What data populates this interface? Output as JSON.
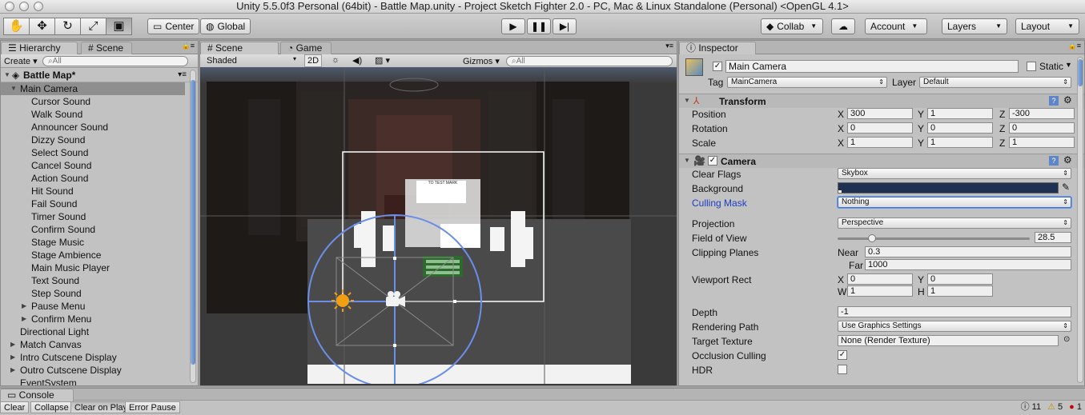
{
  "window": {
    "title": "Unity 5.5.0f3 Personal (64bit) - Battle Map.unity - Project Sketch Fighter 2.0 - PC, Mac & Linux Standalone (Personal) <OpenGL 4.1>"
  },
  "toolbar": {
    "tools": [
      "hand-icon",
      "move-icon",
      "rotate-icon",
      "scale-icon",
      "rect-icon"
    ],
    "pivot": "Center",
    "space": "Global",
    "collab": "Collab",
    "account": "Account",
    "layers": "Layers",
    "layout": "Layout"
  },
  "hierarchy": {
    "tab": "Hierarchy",
    "tab2": "Scene",
    "create": "Create",
    "search_placeholder": "All",
    "scene_name": "Battle Map*",
    "items": [
      {
        "label": "Main Camera",
        "indent": 1,
        "selected": true,
        "arrow": "open"
      },
      {
        "label": "Cursor Sound",
        "indent": 2
      },
      {
        "label": "Walk Sound",
        "indent": 2
      },
      {
        "label": "Announcer Sound",
        "indent": 2
      },
      {
        "label": "Dizzy Sound",
        "indent": 2
      },
      {
        "label": "Select Sound",
        "indent": 2
      },
      {
        "label": "Cancel Sound",
        "indent": 2
      },
      {
        "label": "Action Sound",
        "indent": 2
      },
      {
        "label": "Hit Sound",
        "indent": 2
      },
      {
        "label": "Fail Sound",
        "indent": 2
      },
      {
        "label": "Timer Sound",
        "indent": 2
      },
      {
        "label": "Confirm Sound",
        "indent": 2
      },
      {
        "label": "Stage Music",
        "indent": 2
      },
      {
        "label": "Stage Ambience",
        "indent": 2
      },
      {
        "label": "Main Music Player",
        "indent": 2
      },
      {
        "label": "Text Sound",
        "indent": 2
      },
      {
        "label": "Step Sound",
        "indent": 2
      },
      {
        "label": "Pause Menu",
        "indent": 2,
        "arrow": "closed"
      },
      {
        "label": "Confirm Menu",
        "indent": 2,
        "arrow": "closed"
      },
      {
        "label": "Directional Light",
        "indent": 1
      },
      {
        "label": "Match Canvas",
        "indent": 1,
        "arrow": "closed"
      },
      {
        "label": "Intro Cutscene Display",
        "indent": 1,
        "arrow": "closed"
      },
      {
        "label": "Outro Cutscene Display",
        "indent": 1,
        "arrow": "closed"
      },
      {
        "label": "EventSystem",
        "indent": 1
      }
    ]
  },
  "scene": {
    "tab": "Scene",
    "tab2": "Game",
    "shading": "Shaded",
    "mode2d": "2D",
    "gizmos": "Gizmos",
    "search_placeholder": "All",
    "ui_panel_title": "TO TEST MARK"
  },
  "inspector": {
    "tab": "Inspector",
    "object_name": "Main Camera",
    "static_label": "Static",
    "tag_label": "Tag",
    "tag": "MainCamera",
    "layer_label": "Layer",
    "layer": "Default",
    "transform": {
      "title": "Transform",
      "position_label": "Position",
      "position": {
        "x": "300",
        "y": "1",
        "z": "-300"
      },
      "rotation_label": "Rotation",
      "rotation": {
        "x": "0",
        "y": "0",
        "z": "0"
      },
      "scale_label": "Scale",
      "scale": {
        "x": "1",
        "y": "1",
        "z": "1"
      }
    },
    "camera": {
      "title": "Camera",
      "clear_flags_label": "Clear Flags",
      "clear_flags": "Skybox",
      "background_label": "Background",
      "background_color": "#1f3152",
      "culling_mask_label": "Culling Mask",
      "culling_mask": "Nothing",
      "projection_label": "Projection",
      "projection": "Perspective",
      "fov_label": "Field of View",
      "fov": "28.5",
      "fov_fraction": 0.16,
      "clipping_label": "Clipping Planes",
      "near_label": "Near",
      "near": "0.3",
      "far_label": "Far",
      "far": "1000",
      "viewport_label": "Viewport Rect",
      "vp": {
        "x": "0",
        "y": "0",
        "w": "1",
        "h": "1"
      },
      "depth_label": "Depth",
      "depth": "-1",
      "rendering_path_label": "Rendering Path",
      "rendering_path": "Use Graphics Settings",
      "target_texture_label": "Target Texture",
      "target_texture": "None (Render Texture)",
      "occlusion_label": "Occlusion Culling",
      "hdr_label": "HDR"
    }
  },
  "console": {
    "tab": "Console",
    "buttons": [
      "Clear",
      "Collapse",
      "Clear on Play",
      "Error Pause"
    ],
    "counts": {
      "info": "11",
      "warn": "5",
      "error": "1"
    }
  }
}
